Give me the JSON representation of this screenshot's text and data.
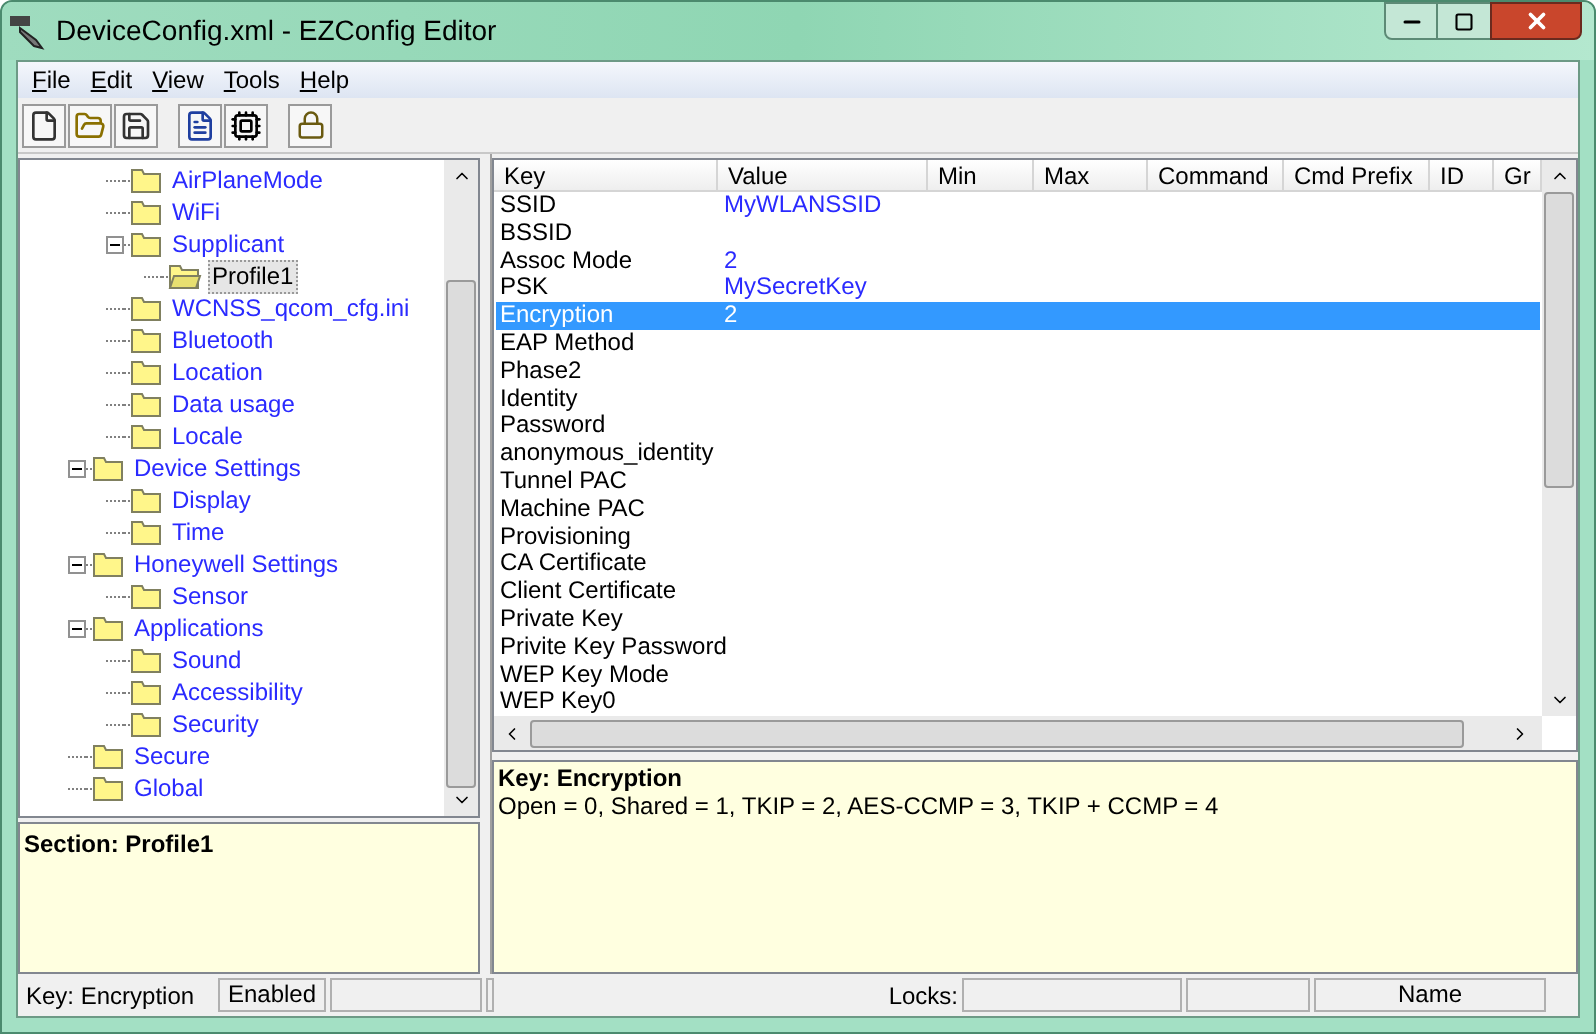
{
  "window": {
    "title": "DeviceConfig.xml - EZConfig Editor"
  },
  "menu": [
    "File",
    "Edit",
    "View",
    "Tools",
    "Help"
  ],
  "tree": {
    "items": [
      {
        "children": [
          {
            "label": "AirPlaneMode",
            "selected": false
          },
          {
            "label": "WiFi",
            "selected": false
          },
          {
            "label": "Supplicant",
            "selected": false,
            "expanded": true,
            "children": [
              {
                "label": "Profile1",
                "selected": true
              }
            ]
          },
          {
            "label": "WCNSS_qcom_cfg.ini",
            "selected": false
          },
          {
            "label": "Bluetooth",
            "selected": false
          },
          {
            "label": "Location",
            "selected": false
          },
          {
            "label": "Data usage",
            "selected": false
          },
          {
            "label": "Locale",
            "selected": false
          }
        ]
      },
      {
        "label": "Device Settings",
        "selected": false,
        "expanded": true,
        "children": [
          {
            "label": "Display",
            "selected": false
          },
          {
            "label": "Time",
            "selected": false
          }
        ]
      },
      {
        "label": "Honeywell Settings",
        "selected": false,
        "expanded": true,
        "children": [
          {
            "label": "Sensor",
            "selected": false
          }
        ]
      },
      {
        "label": "Applications",
        "selected": false,
        "expanded": true,
        "children": [
          {
            "label": "Sound",
            "selected": false
          },
          {
            "label": "Accessibility",
            "selected": false
          },
          {
            "label": "Security",
            "selected": false
          }
        ]
      },
      {
        "label": "Secure",
        "selected": false
      },
      {
        "label": "Global",
        "selected": false
      }
    ]
  },
  "section_info": {
    "title": "Section: Profile1"
  },
  "table": {
    "columns": [
      "Key",
      "Value",
      "Min",
      "Max",
      "Command",
      "Cmd Prefix",
      "ID",
      "Gr"
    ],
    "rows": [
      {
        "key": "SSID",
        "value": "MyWLANSSID",
        "selected": false
      },
      {
        "key": "BSSID",
        "selected": false
      },
      {
        "key": "Assoc Mode",
        "value": "2",
        "selected": false
      },
      {
        "key": "PSK",
        "value": "MySecretKey",
        "selected": false
      },
      {
        "key": "Encryption",
        "value": "2",
        "selected": true
      },
      {
        "key": "EAP Method",
        "selected": false
      },
      {
        "key": "Phase2",
        "selected": false
      },
      {
        "key": "Identity",
        "selected": false
      },
      {
        "key": "Password",
        "selected": false
      },
      {
        "key": "anonymous_identity",
        "selected": false
      },
      {
        "key": "Tunnel PAC",
        "selected": false
      },
      {
        "key": "Machine PAC",
        "selected": false
      },
      {
        "key": "Provisioning",
        "selected": false
      },
      {
        "key": "CA Certificate",
        "selected": false
      },
      {
        "key": "Client Certificate",
        "selected": false
      },
      {
        "key": "Private Key",
        "selected": false
      },
      {
        "key": "Privite Key Password",
        "selected": false
      },
      {
        "key": "WEP Key Mode",
        "selected": false
      },
      {
        "key": "WEP Key0",
        "selected": false
      }
    ]
  },
  "key_info": {
    "title": "Key: Encryption",
    "description": "Open = 0, Shared = 1, TKIP = 2, AES-CCMP = 3, TKIP + CCMP = 4"
  },
  "status_bar": {
    "key": "Key: Encryption",
    "state": "Enabled",
    "locks_label": "Locks:",
    "name": "Name"
  }
}
